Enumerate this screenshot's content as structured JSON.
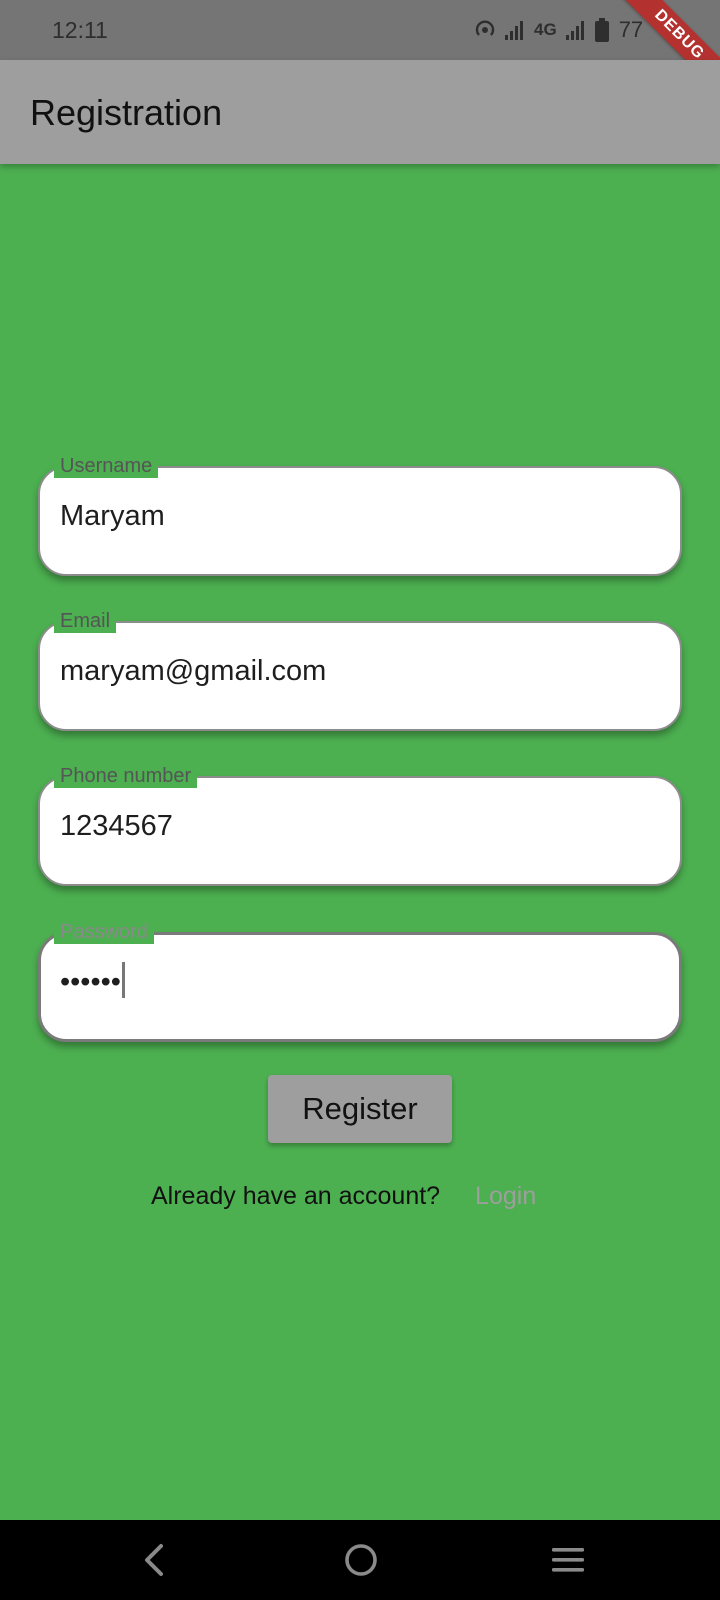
{
  "status_bar": {
    "time": "12:11",
    "network": "4G",
    "battery": "77",
    "icons": [
      "hotspot-icon",
      "signal-icon",
      "signal-icon",
      "battery-icon"
    ]
  },
  "debug_banner": "DEBUG",
  "app_bar": {
    "title": "Registration"
  },
  "form": {
    "username": {
      "label": "Username",
      "value": "Maryam"
    },
    "email": {
      "label": "Email",
      "value": "maryam@gmail.com"
    },
    "phone": {
      "label": "Phone number",
      "value": "1234567"
    },
    "password": {
      "label": "Password",
      "value": "••••••"
    }
  },
  "register_label": "Register",
  "account_prompt": "Already have an account?",
  "login_label": "Login",
  "nav": {
    "icons": [
      "back-icon",
      "home-icon",
      "menu-icon"
    ]
  },
  "colors": {
    "background": "#4caf50",
    "app_bar": "#9e9e9e",
    "status_bar": "#757575",
    "debug": "#b3322f"
  }
}
